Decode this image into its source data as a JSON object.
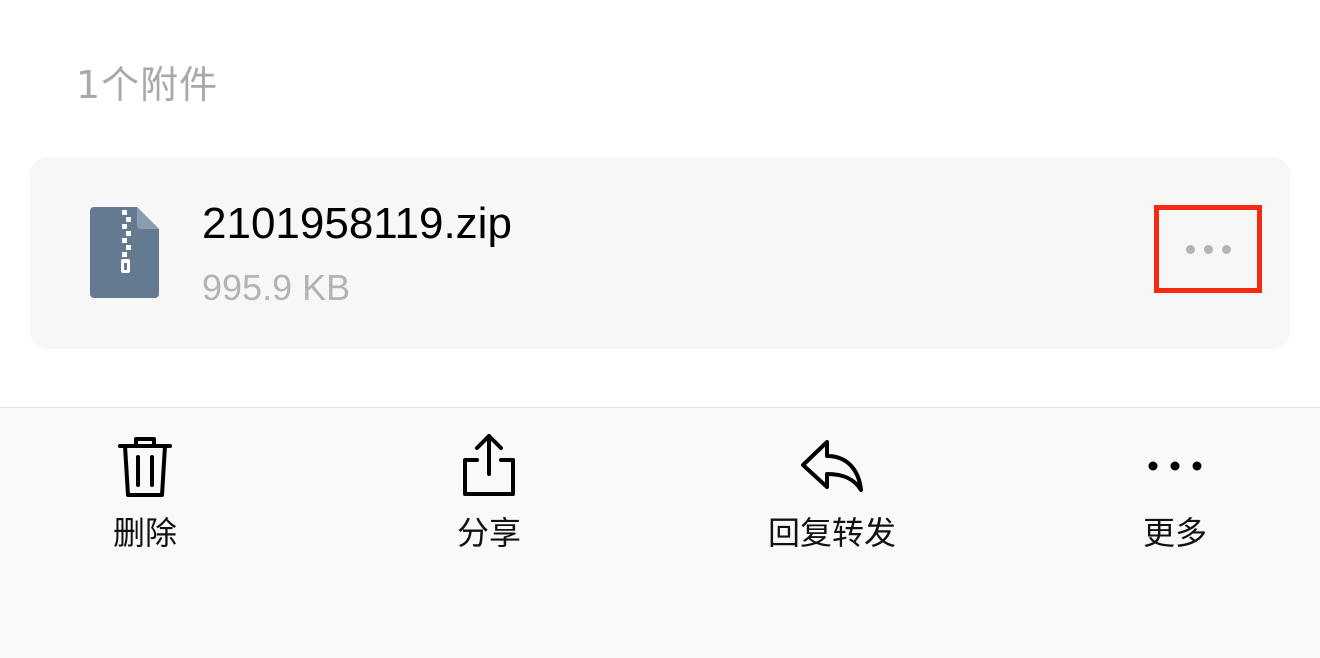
{
  "attachments": {
    "count_label": "1个附件"
  },
  "file": {
    "name": "2101958119.zip",
    "size": "995.9 KB",
    "icon": "zip-file-icon"
  },
  "card_actions": {
    "more_icon": "ellipsis-icon",
    "highlight_color": "#f32b10"
  },
  "toolbar": {
    "items": [
      {
        "label": "删除",
        "icon": "trash-icon"
      },
      {
        "label": "分享",
        "icon": "share-icon"
      },
      {
        "label": "回复转发",
        "icon": "reply-icon"
      },
      {
        "label": "更多",
        "icon": "ellipsis-icon"
      }
    ]
  }
}
